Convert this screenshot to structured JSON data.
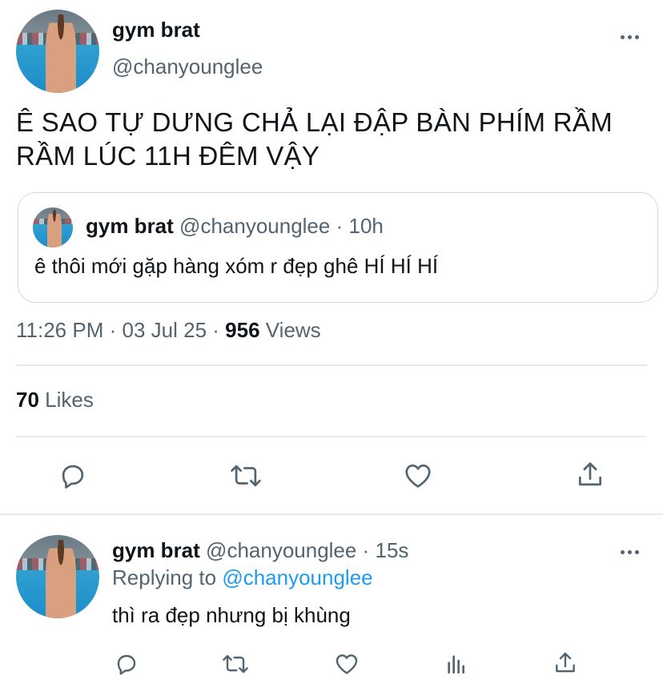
{
  "main_tweet": {
    "display_name": "gym brat",
    "handle": "@chanyounglee",
    "text_line1": "Ê SAO TỰ DƯNG CHẢ LẠI ĐẬP BÀN PHÍM RẦM",
    "text_line2": "RẦM LÚC 11H ĐÊM VẬY",
    "more_icon": "more-horizontal-icon"
  },
  "quoted_tweet": {
    "display_name": "gym brat",
    "handle": "@chanyounglee",
    "separator": "·",
    "time": "10h",
    "text": "ê thôi mới gặp hàng xóm r đẹp ghê HÍ HÍ HÍ"
  },
  "meta": {
    "time": "11:26 PM",
    "separator": "·",
    "date": "03 Jul 25",
    "views_count": "956",
    "views_label": "Views"
  },
  "stats": {
    "likes_count": "70",
    "likes_label": "Likes"
  },
  "actions": {
    "icons": [
      "reply-icon",
      "retweet-icon",
      "like-icon",
      "share-icon"
    ]
  },
  "reply": {
    "display_name": "gym brat",
    "handle": "@chanyounglee",
    "separator": "·",
    "time": "15s",
    "replying_prefix": "Replying to",
    "replying_handle": "@chanyounglee",
    "text": "thì ra đẹp nhưng bị khùng",
    "icons": [
      "reply-icon",
      "retweet-icon",
      "like-icon",
      "analytics-icon",
      "share-icon"
    ]
  },
  "colors": {
    "text": "#0f1419",
    "muted": "#536471",
    "link": "#1d9bf0",
    "border": "#cfd9de"
  }
}
